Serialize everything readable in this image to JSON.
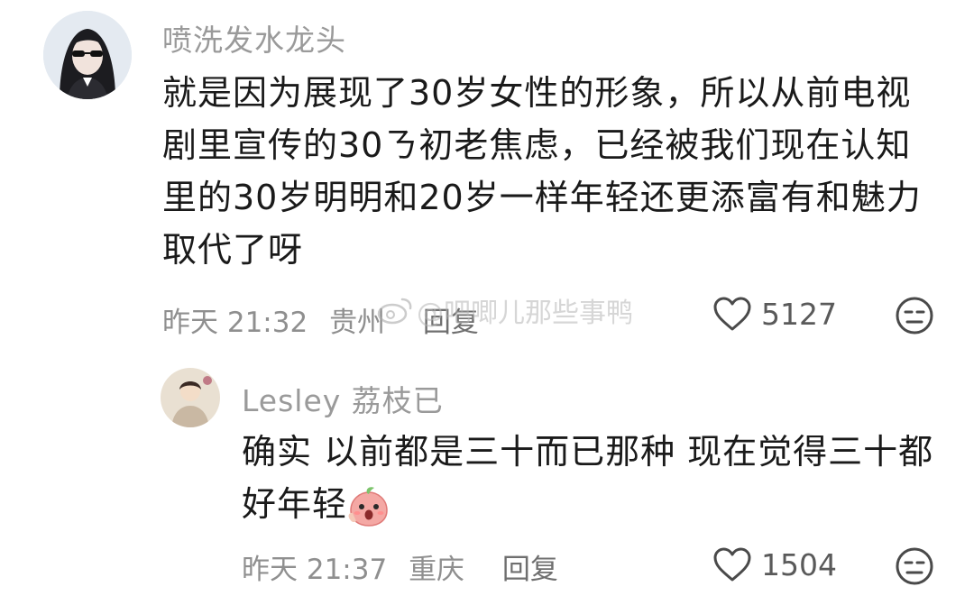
{
  "comments": [
    {
      "username": "喷洗发水龙头",
      "lines": [
        "就是因为展现了30岁女性的形象，所以从前电视",
        "剧里宣传的30ㄋ初老焦虑，已经被我们现在认知",
        "里的30岁明明和20岁一样年轻还更添富有和魅力",
        "取代了呀"
      ],
      "time": "昨天 21:32",
      "location": "贵州",
      "reply_label": "回复",
      "likes": "5127"
    },
    {
      "username": "Lesley 荔枝已",
      "lines": [
        "确实 以前都是三十而已那种 现在觉得三十都",
        "好年轻"
      ],
      "time": "昨天 21:37",
      "location": "重庆",
      "reply_label": "回复",
      "likes": "1504",
      "avatar_text": "Lesley"
    }
  ],
  "watermark": "@吧唧儿那些事鸭",
  "icons": [
    "heart-icon",
    "dislike-face-icon",
    "weibo-icon",
    "shocked-peach-emoji"
  ],
  "colors": {
    "username": "#9a9a9a",
    "text": "#1a1a1a",
    "meta": "#8f8f8f"
  }
}
